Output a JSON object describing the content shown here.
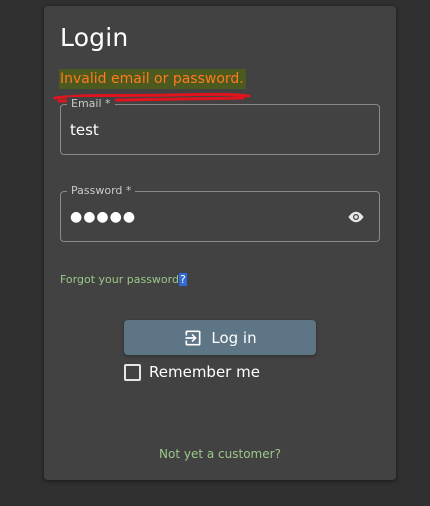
{
  "card": {
    "title": "Login",
    "error": "Invalid email or password.",
    "email": {
      "label": "Email *",
      "value": "test"
    },
    "password": {
      "label": "Password *",
      "value": "●●●●●",
      "toggle_icon": "eye-icon"
    },
    "forgot": {
      "text": "Forgot your password",
      "suffix": "?"
    },
    "login_button": {
      "label": "Log in",
      "icon": "login-icon"
    },
    "remember": {
      "label": "Remember me",
      "checked": false
    },
    "signup": "Not yet a customer?"
  },
  "colors": {
    "background": "#303030",
    "card": "#424242",
    "error_text": "#ff7a1a",
    "error_highlight": "#4d5a1f",
    "annotation": "#e0141e",
    "link": "#9cc78a",
    "button": "#5d7584"
  }
}
